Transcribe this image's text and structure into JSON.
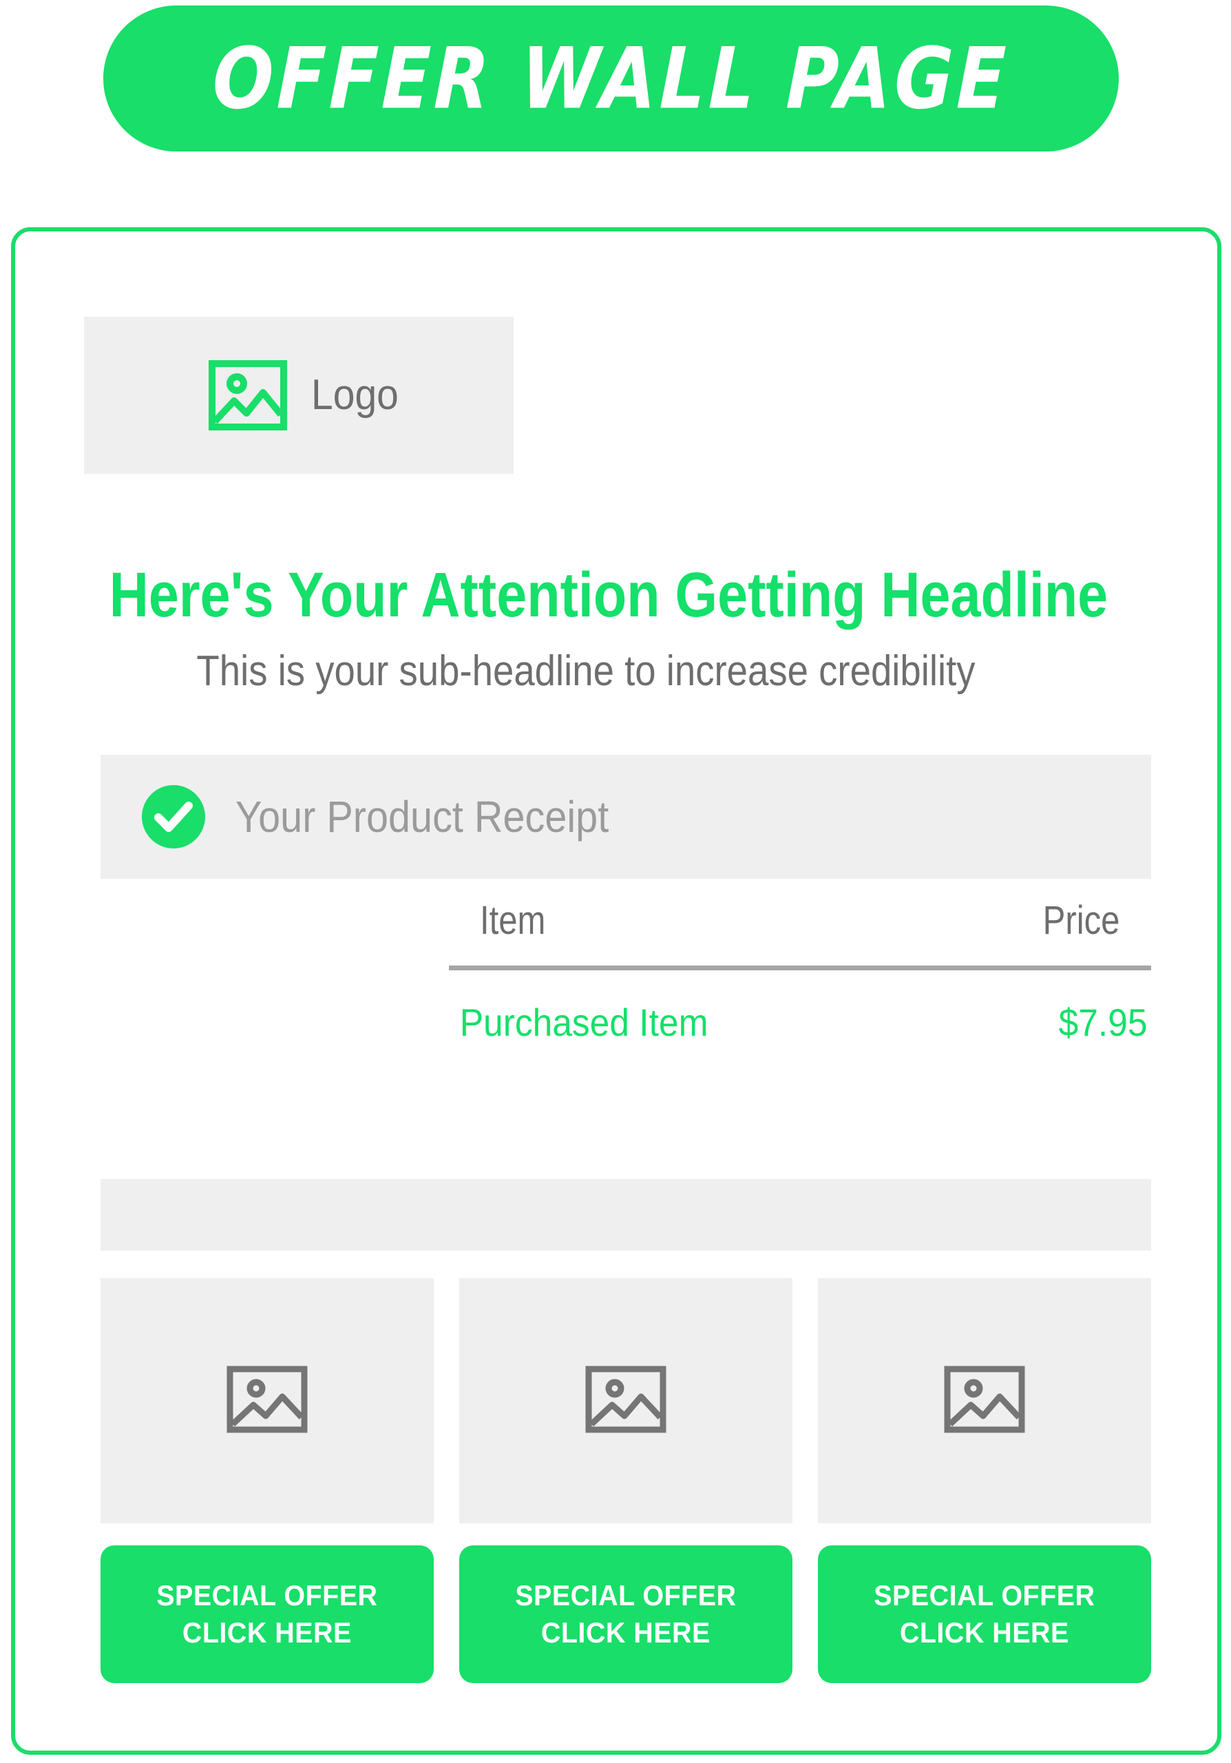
{
  "banner": {
    "title": "OFFER WALL PAGE"
  },
  "colors": {
    "accent_green": "#19DE69",
    "headline_green": "#14E06A",
    "placeholder_gray": "#EFEFEF",
    "text_gray": "#6E6E6E",
    "muted_gray": "#9B9B9B",
    "divider_gray": "#A5A5A5",
    "white": "#FFFFFF"
  },
  "logo": {
    "icon": "image-placeholder-icon",
    "label": "Logo"
  },
  "hero": {
    "headline": "Here's Your Attention Getting Headline",
    "subheadline": "This is your sub-headline to increase credibility"
  },
  "receipt": {
    "status_icon": "check-circle-icon",
    "title": "Your Product Receipt",
    "table": {
      "columns": [
        "Item",
        "Price"
      ],
      "rows": [
        {
          "item": "Purchased Item",
          "price": "$7.95"
        }
      ]
    }
  },
  "offers": [
    {
      "thumb_icon": "image-placeholder-icon",
      "button_line1": "SPECIAL OFFER",
      "button_line2": "CLICK HERE"
    },
    {
      "thumb_icon": "image-placeholder-icon",
      "button_line1": "SPECIAL OFFER",
      "button_line2": "CLICK HERE"
    },
    {
      "thumb_icon": "image-placeholder-icon",
      "button_line1": "SPECIAL OFFER",
      "button_line2": "CLICK HERE"
    }
  ]
}
